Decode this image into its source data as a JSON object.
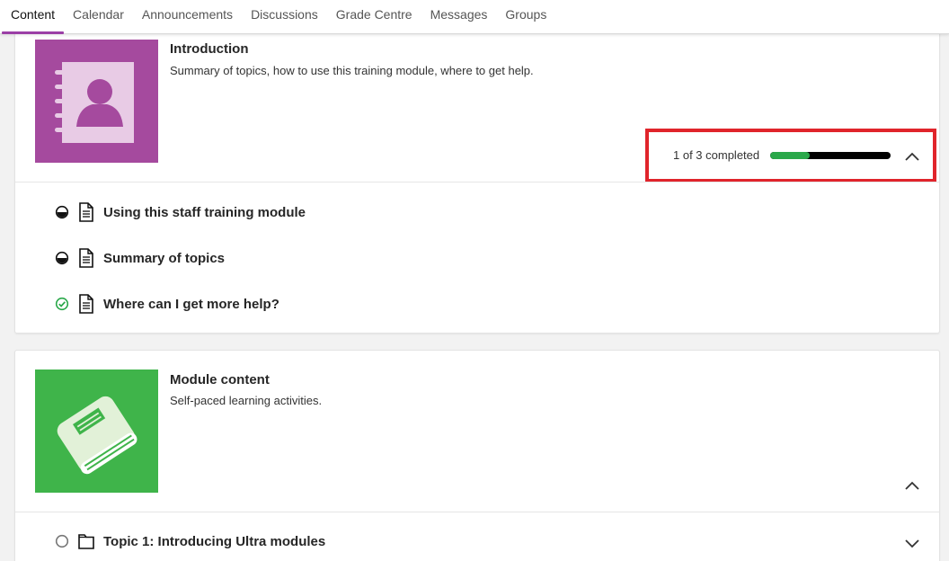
{
  "nav": {
    "tabs": [
      {
        "label": "Content",
        "active": true
      },
      {
        "label": "Calendar"
      },
      {
        "label": "Announcements"
      },
      {
        "label": "Discussions"
      },
      {
        "label": "Grade Centre"
      },
      {
        "label": "Messages"
      },
      {
        "label": "Groups"
      }
    ],
    "accent_color": "#9b3fa6"
  },
  "intro_module": {
    "title": "Introduction",
    "description": "Summary of topics, how to use this training module, where to get help.",
    "thumbnail_icon": "contact-book-icon",
    "thumbnail_color": "#a54a9e",
    "progress": {
      "text": "1 of 3 completed",
      "completed": 1,
      "total": 3,
      "fraction": 0.33,
      "fill_color": "#2aa84a",
      "highlight_color": "#e0242b"
    },
    "items": [
      {
        "label": "Using this staff training module",
        "status": "in-progress",
        "icon": "document-icon"
      },
      {
        "label": "Summary of topics",
        "status": "in-progress",
        "icon": "document-icon"
      },
      {
        "label": "Where can I get more help?",
        "status": "completed",
        "icon": "document-icon"
      }
    ]
  },
  "content_module": {
    "title": "Module content",
    "description": "Self-paced learning activities.",
    "thumbnail_icon": "book-icon",
    "thumbnail_color": "#3fb44a",
    "items": [
      {
        "label": "Topic 1: Introducing Ultra modules",
        "status": "not-started",
        "icon": "folder-icon"
      }
    ]
  }
}
